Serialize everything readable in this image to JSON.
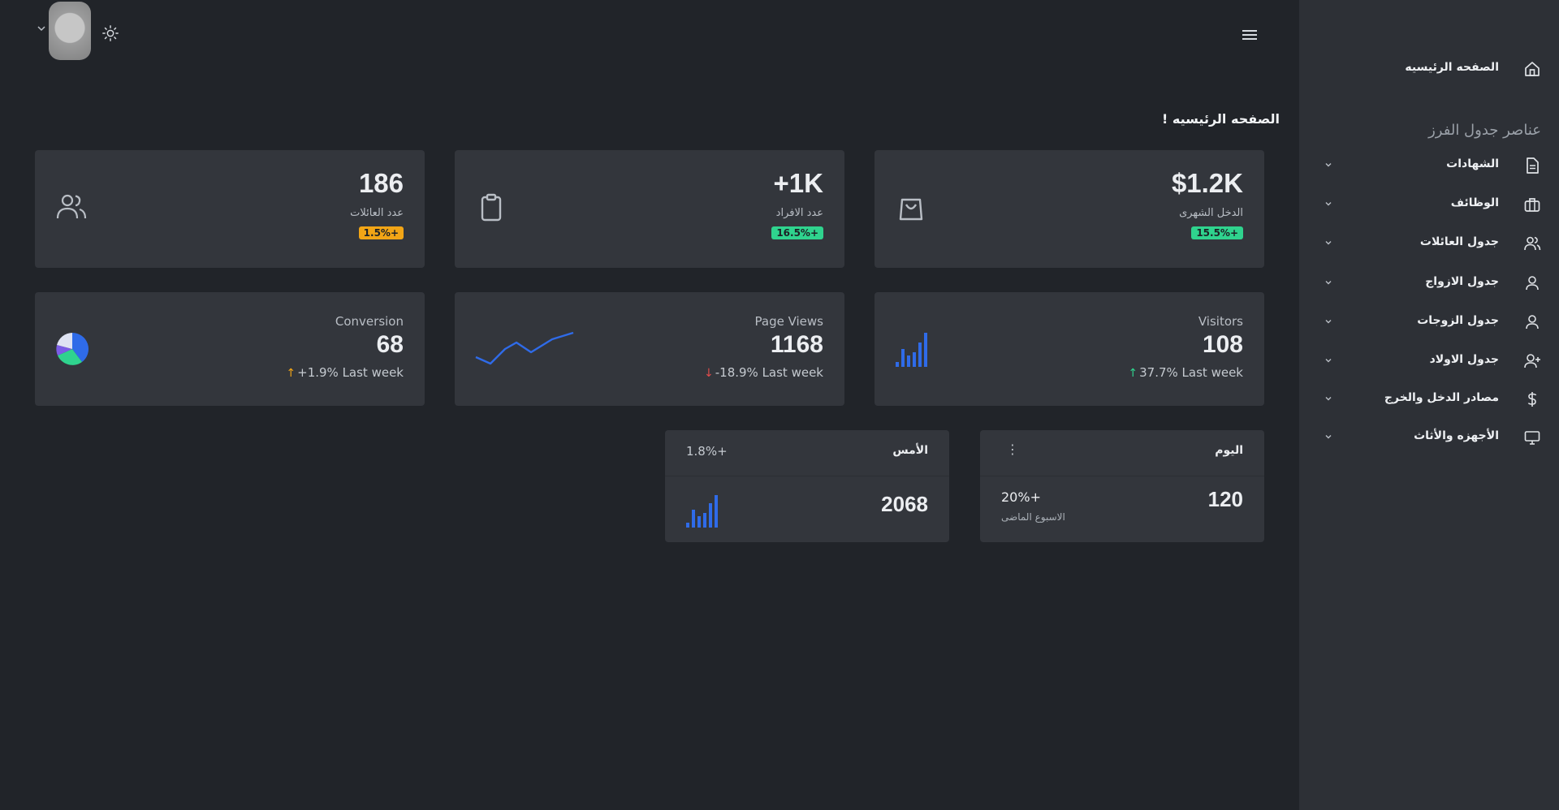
{
  "header": {
    "user_menu_icon": "chevron-down-icon",
    "theme_icon": "sun-icon",
    "menu_icon": "hamburger-icon"
  },
  "page": {
    "title": "الصفحه الرئيسيه !"
  },
  "stats": [
    {
      "value": "$1.2K",
      "label": "الدخل الشهرى",
      "badge": "15.5%+",
      "badge_color": "#2fd38e",
      "icon": "shopping-bag-icon"
    },
    {
      "value": "+1K",
      "label": "عدد الافراد",
      "badge": "16.5%+",
      "badge_color": "#2fd38e",
      "icon": "clipboard-icon"
    },
    {
      "value": "186",
      "label": "عدد العائلات",
      "badge": "1.5%+",
      "badge_color": "#f2a516",
      "icon": "users-icon"
    }
  ],
  "metrics": [
    {
      "title": "Visitors",
      "value": "108",
      "change": "37.7% Last week",
      "direction": "up",
      "arrow_color": "#2fd38e",
      "chart_icon": "bar-chart-icon"
    },
    {
      "title": "Page Views",
      "value": "1168",
      "change": "-18.9% Last week",
      "direction": "down",
      "arrow_color": "#e04b4b",
      "chart_icon": "line-chart-icon"
    },
    {
      "title": "Conversion",
      "value": "68",
      "change": "+1.9% Last week",
      "direction": "up",
      "arrow_color": "#f2a516",
      "chart_icon": "pie-chart-icon"
    }
  ],
  "today_card": {
    "label": "اليوم",
    "value": "120",
    "change": "20%+",
    "change_caption": "الاسبوع الماضى",
    "more_icon": "more-vertical-icon"
  },
  "yesterday_card": {
    "label": "الأمس",
    "change": "1.8%+",
    "value": "2068",
    "chart_icon": "bar-chart-icon"
  },
  "sidebar": {
    "home": {
      "label": "الصفحه الرئيسيه",
      "icon": "home-icon"
    },
    "section_title": "عناصر جدول الفرز",
    "items": [
      {
        "label": "الشهادات",
        "icon": "document-icon"
      },
      {
        "label": "الوظائف",
        "icon": "briefcase-icon"
      },
      {
        "label": "جدول العائلات",
        "icon": "users-icon"
      },
      {
        "label": "جدول الازواج",
        "icon": "user-icon"
      },
      {
        "label": "جدول الزوجات",
        "icon": "user-icon"
      },
      {
        "label": "جدول الاولاد",
        "icon": "user-plus-icon"
      },
      {
        "label": "مصادر الدخل والخرج",
        "icon": "dollar-icon"
      },
      {
        "label": "الأجهزه والأثاث",
        "icon": "monitor-icon"
      }
    ]
  },
  "colors": {
    "accent_blue": "#2f6be8",
    "sidebar_bg": "#2d3036",
    "card_bg": "#33363c",
    "page_bg": "#212429"
  }
}
